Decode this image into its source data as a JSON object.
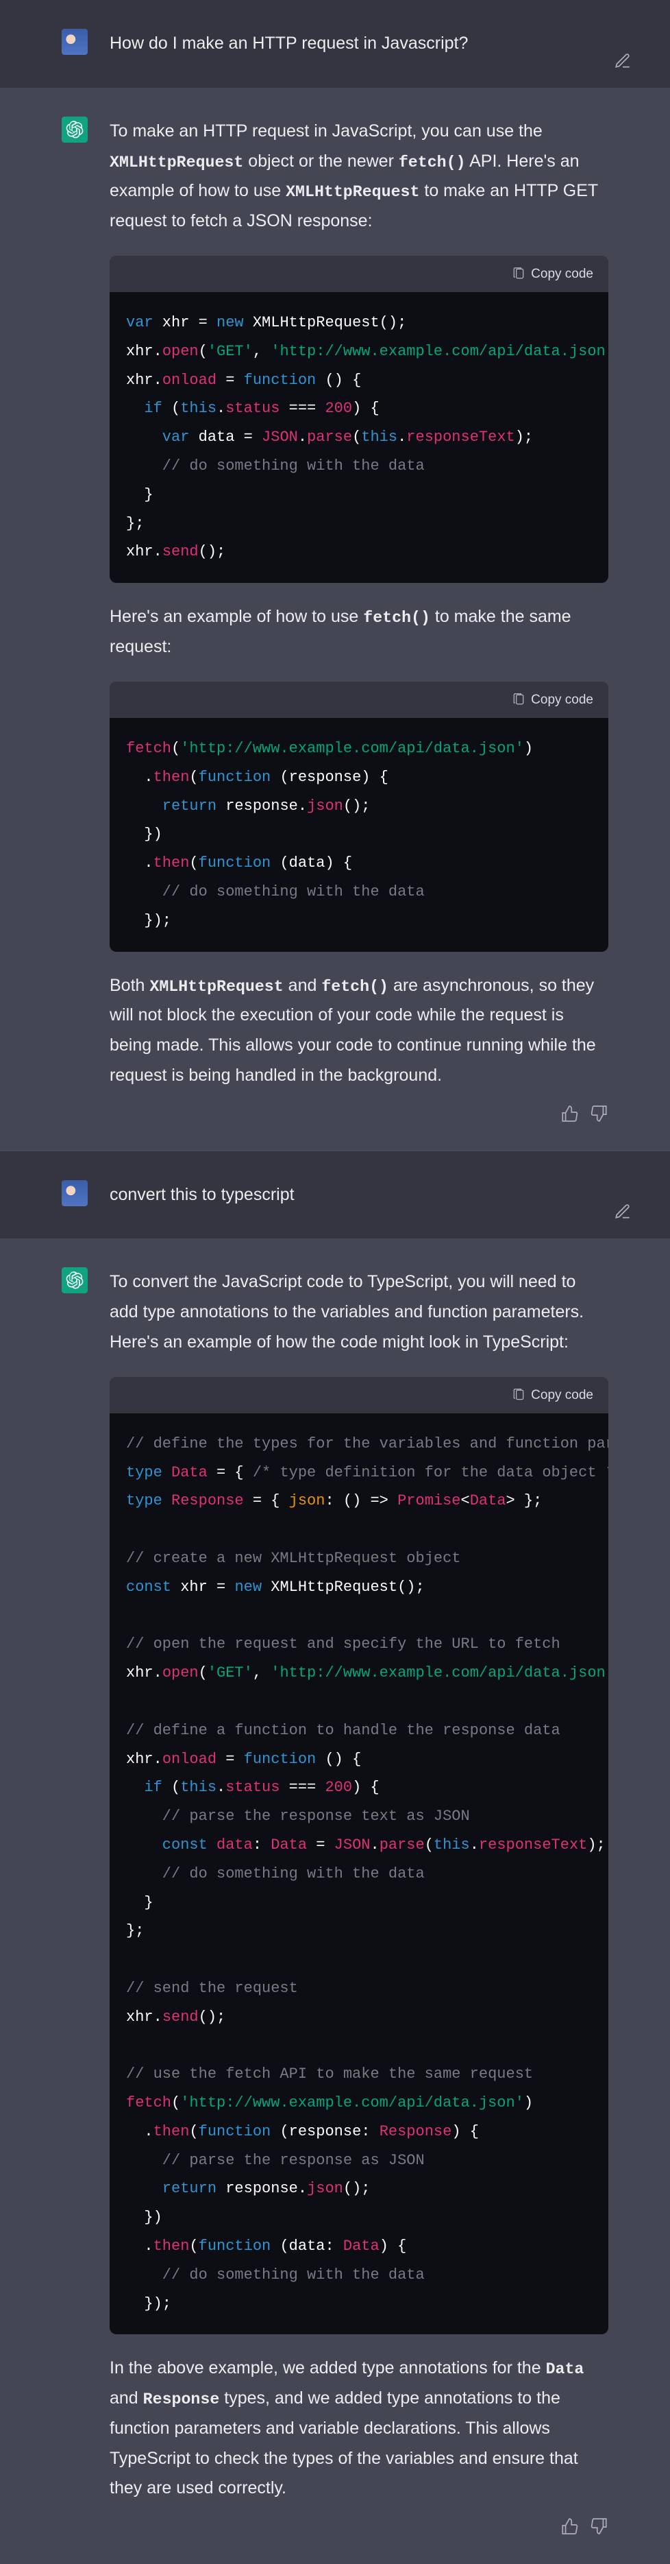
{
  "messages": {
    "u1": {
      "text": "How do I make an HTTP request in Javascript?"
    },
    "a1": {
      "p1_pre": "To make an HTTP request in JavaScript, you can use the ",
      "p1_c1": "XMLHttpRequest",
      "p1_mid1": " object or the newer ",
      "p1_c2": "fetch()",
      "p1_mid2": " API. Here's an example of how to use ",
      "p1_c3": "XMLHttpRequest",
      "p1_post": " to make an HTTP GET request to fetch a JSON response:",
      "copy_label": "Copy code",
      "p2_pre": "Here's an example of how to use ",
      "p2_c1": "fetch()",
      "p2_post": " to make the same request:",
      "p3_pre": "Both ",
      "p3_c1": "XMLHttpRequest",
      "p3_mid": " and ",
      "p3_c2": "fetch()",
      "p3_post": " are asynchronous, so they will not block the execution of your code while the request is being made. This allows your code to continue running while the request is being handled in the background."
    },
    "u2": {
      "text": "convert this to typescript"
    },
    "a2": {
      "p1": "To convert the JavaScript code to TypeScript, you will need to add type annotations to the variables and function parameters. Here's an example of how the code might look in TypeScript:",
      "copy_label": "Copy code",
      "p2_pre": "In the above example, we added type annotations for the ",
      "p2_c1": "Data",
      "p2_mid": " and ",
      "p2_c2": "Response",
      "p2_post": " types, and we added type annotations to the function parameters and variable declarations. This allows TypeScript to check the types of the variables and ensure that they are used correctly."
    }
  },
  "code": {
    "xhr_js": {
      "l1": {
        "a": "var",
        "b": " xhr = ",
        "c": "new",
        "d": " XMLHttpRequest();"
      },
      "l2": {
        "a": "xhr.",
        "b": "open",
        "c": "(",
        "d": "'GET'",
        "e": ", ",
        "f": "'http://www.example.com/api/data.json'",
        "g": ", ",
        "h": "true",
        "i": ");"
      },
      "l3": {
        "a": "xhr.",
        "b": "onload",
        "c": " = ",
        "d": "function",
        "e": " () {"
      },
      "l4": {
        "a": "  if",
        "b": " (",
        "c": "this",
        "d": ".",
        "e": "status",
        "f": " === ",
        "g": "200",
        "h": ") {"
      },
      "l5": {
        "a": "    var",
        "b": " data = ",
        "c": "JSON",
        "d": ".",
        "e": "parse",
        "f": "(",
        "g": "this",
        "h": ".",
        "i": "responseText",
        "j": ");"
      },
      "l6": {
        "a": "    // do something with the data"
      },
      "l7": {
        "a": "  }"
      },
      "l8": {
        "a": "};"
      },
      "l9": {
        "a": "xhr.",
        "b": "send",
        "c": "();"
      }
    },
    "fetch_js": {
      "l1": {
        "a": "fetch",
        "b": "(",
        "c": "'http://www.example.com/api/data.json'",
        "d": ")"
      },
      "l2": {
        "a": "  .",
        "b": "then",
        "c": "(",
        "d": "function",
        "e": " (response) {"
      },
      "l3": {
        "a": "    return",
        "b": " response.",
        "c": "json",
        "d": "();"
      },
      "l4": {
        "a": "  })"
      },
      "l5": {
        "a": "  .",
        "b": "then",
        "c": "(",
        "d": "function",
        "e": " (data) {"
      },
      "l6": {
        "a": "    // do something with the data"
      },
      "l7": {
        "a": "  });"
      }
    },
    "ts": {
      "l1": {
        "a": "// define the types for the variables and function parameters"
      },
      "l2": {
        "a": "type ",
        "b": "Data",
        "c": " = { ",
        "d": "/* type definition for the data object */",
        "e": " };"
      },
      "l3": {
        "a": "type ",
        "b": "Response",
        "c": " = { ",
        "d": "json",
        "e": ": () => ",
        "f": "Promise",
        "g": "<",
        "h": "Data",
        "i": "> };"
      },
      "l4": {
        "a": ""
      },
      "l5": {
        "a": "// create a new XMLHttpRequest object"
      },
      "l6": {
        "a": "const",
        "b": " xhr = ",
        "c": "new",
        "d": " XMLHttpRequest();"
      },
      "l7": {
        "a": ""
      },
      "l8": {
        "a": "// open the request and specify the URL to fetch"
      },
      "l9": {
        "a": "xhr.",
        "b": "open",
        "c": "(",
        "d": "'GET'",
        "e": ", ",
        "f": "'http://www.example.com/api/data.json'",
        "g": ", ",
        "h": "true",
        "i": ");"
      },
      "l10": {
        "a": ""
      },
      "l11": {
        "a": "// define a function to handle the response data"
      },
      "l12": {
        "a": "xhr.",
        "b": "onload",
        "c": " = ",
        "d": "function",
        "e": " () {"
      },
      "l13": {
        "a": "  if",
        "b": " (",
        "c": "this",
        "d": ".",
        "e": "status",
        "f": " === ",
        "g": "200",
        "h": ") {"
      },
      "l14": {
        "a": "    // parse the response text as JSON"
      },
      "l15": {
        "a": "    const",
        "b": " ",
        "c": "data",
        "d": ": ",
        "e": "Data",
        "f": " = ",
        "g": "JSON",
        "h": ".",
        "i": "parse",
        "j": "(",
        "k": "this",
        "l": ".",
        "m": "responseText",
        "n": ");"
      },
      "l16": {
        "a": "    // do something with the data"
      },
      "l17": {
        "a": "  }"
      },
      "l18": {
        "a": "};"
      },
      "l19": {
        "a": ""
      },
      "l20": {
        "a": "// send the request"
      },
      "l21": {
        "a": "xhr.",
        "b": "send",
        "c": "();"
      },
      "l22": {
        "a": ""
      },
      "l23": {
        "a": "// use the fetch API to make the same request"
      },
      "l24": {
        "a": "fetch",
        "b": "(",
        "c": "'http://www.example.com/api/data.json'",
        "d": ")"
      },
      "l25": {
        "a": "  .",
        "b": "then",
        "c": "(",
        "d": "function",
        "e": " (",
        "f": "response",
        "g": ": ",
        "h": "Response",
        "i": ") {"
      },
      "l26": {
        "a": "    // parse the response as JSON"
      },
      "l27": {
        "a": "    return",
        "b": " response.",
        "c": "json",
        "d": "();"
      },
      "l28": {
        "a": "  })"
      },
      "l29": {
        "a": "  .",
        "b": "then",
        "c": "(",
        "d": "function",
        "e": " (",
        "f": "data",
        "g": ": ",
        "h": "Data",
        "i": ") {"
      },
      "l30": {
        "a": "    // do something with the data"
      },
      "l31": {
        "a": "  });"
      }
    }
  }
}
